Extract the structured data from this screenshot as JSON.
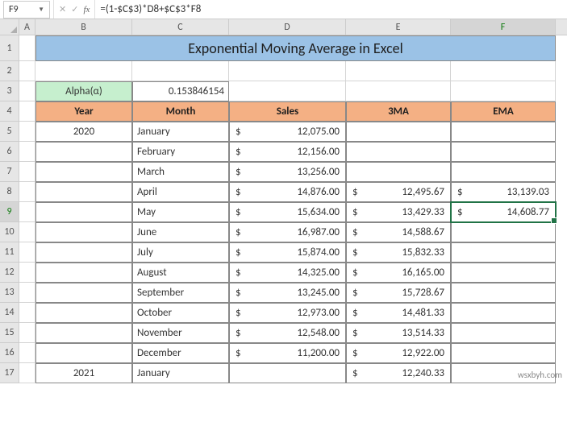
{
  "namebox": "F9",
  "formula": "=(1-$C$3)*D8+$C$3*F8",
  "columns": [
    "A",
    "B",
    "C",
    "D",
    "E",
    "F"
  ],
  "activeCol": "F",
  "activeRow": "9",
  "title": "Exponential Moving Average in Excel",
  "alpha": {
    "label": "Alpha(α)",
    "value": "0.153846154"
  },
  "headers": {
    "year": "Year",
    "month": "Month",
    "sales": "Sales",
    "ma3": "3MA",
    "ema": "EMA"
  },
  "rows": [
    {
      "n": "5",
      "year": "2020",
      "month": "January",
      "sales": "12,075.00",
      "ma3": "",
      "ema": ""
    },
    {
      "n": "6",
      "year": "",
      "month": "February",
      "sales": "12,156.00",
      "ma3": "",
      "ema": ""
    },
    {
      "n": "7",
      "year": "",
      "month": "March",
      "sales": "13,256.00",
      "ma3": "",
      "ema": ""
    },
    {
      "n": "8",
      "year": "",
      "month": "April",
      "sales": "14,876.00",
      "ma3": "12,495.67",
      "ema": "13,139.03"
    },
    {
      "n": "9",
      "year": "",
      "month": "May",
      "sales": "15,634.00",
      "ma3": "13,429.33",
      "ema": "14,608.77"
    },
    {
      "n": "10",
      "year": "",
      "month": "June",
      "sales": "16,987.00",
      "ma3": "14,588.67",
      "ema": ""
    },
    {
      "n": "11",
      "year": "",
      "month": "July",
      "sales": "15,874.00",
      "ma3": "15,832.33",
      "ema": ""
    },
    {
      "n": "12",
      "year": "",
      "month": "August",
      "sales": "14,325.00",
      "ma3": "16,165.00",
      "ema": ""
    },
    {
      "n": "13",
      "year": "",
      "month": "September",
      "sales": "13,245.00",
      "ma3": "15,728.67",
      "ema": ""
    },
    {
      "n": "14",
      "year": "",
      "month": "October",
      "sales": "12,973.00",
      "ma3": "14,481.33",
      "ema": ""
    },
    {
      "n": "15",
      "year": "",
      "month": "November",
      "sales": "12,548.00",
      "ma3": "13,514.33",
      "ema": ""
    },
    {
      "n": "16",
      "year": "",
      "month": "December",
      "sales": "11,200.00",
      "ma3": "12,922.00",
      "ema": ""
    },
    {
      "n": "17",
      "year": "2021",
      "month": "January",
      "sales": "",
      "ma3": "12,240.33",
      "ema": ""
    }
  ],
  "watermark": "wsxbyh.com",
  "currency": "$"
}
